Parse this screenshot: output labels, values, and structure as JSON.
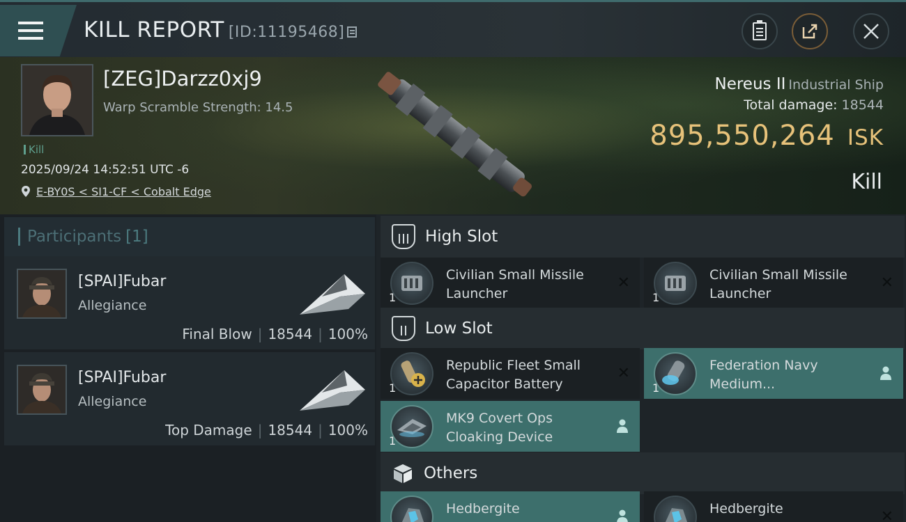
{
  "header": {
    "title": "KILL REPORT",
    "report_id": "[ID:11195468]"
  },
  "victim": {
    "pilot": "[ZEG]Darzz0xj9",
    "warp_scramble": "Warp Scramble Strength: 14.5",
    "tag": "Kill",
    "datetime": "2025/09/24 14:52:51 UTC -6",
    "location": "E-BY0S < SI1-CF < Cobalt Edge",
    "ship": "Nereus II",
    "ship_class": "Industrial Ship",
    "total_damage_label": "Total damage:",
    "total_damage": "18544",
    "isk_value": "895,550,264",
    "isk_unit": "ISK",
    "result": "Kill"
  },
  "participants": {
    "label": "Participants",
    "count": "[1]",
    "rows": [
      {
        "name": "[SPAI]Fubar",
        "corp": "Allegiance",
        "role": "Final Blow",
        "damage": "18544",
        "percent": "100%"
      },
      {
        "name": "[SPAI]Fubar",
        "corp": "Allegiance",
        "role": "Top Damage",
        "damage": "18544",
        "percent": "100%"
      }
    ]
  },
  "fitting": {
    "high_slot": {
      "label": "High Slot",
      "modules": [
        {
          "name": "Civilian Small Missile Launcher",
          "qty": "1"
        },
        {
          "name": "Civilian Small Missile Launcher",
          "qty": "1"
        }
      ]
    },
    "low_slot": {
      "label": "Low Slot",
      "modules": [
        {
          "name": "Republic Fleet Small Capacitor Battery",
          "qty": "1"
        },
        {
          "name": "Federation Navy Medium...",
          "qty": "1"
        },
        {
          "name": "MK9 Covert Ops Cloaking Device",
          "qty": "1"
        }
      ]
    },
    "others": {
      "label": "Others",
      "modules": [
        {
          "name": "Hedbergite",
          "qty": ""
        },
        {
          "name": "Hedbergite",
          "qty": ""
        }
      ]
    }
  },
  "colors": {
    "accent_teal": "#3d6f6c",
    "isk_gold": "#e7c27a",
    "kill_green": "#5f9f8d"
  }
}
